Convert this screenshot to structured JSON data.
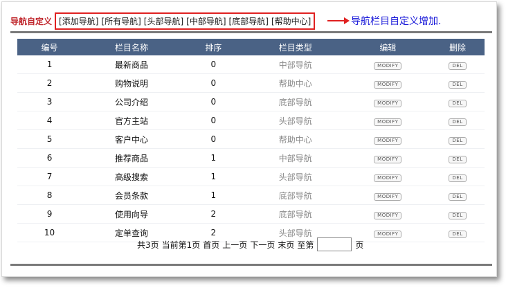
{
  "header": {
    "title": "导航自定义",
    "nav_links": [
      "[添加导航]",
      "[所有导航]",
      "[头部导航]",
      "[中部导航]",
      "[底部导航]",
      "[帮助中心]"
    ]
  },
  "annotation": "导航栏目自定义增加.",
  "table": {
    "columns": [
      "编号",
      "栏目名称",
      "排序",
      "栏目类型",
      "编辑",
      "删除"
    ],
    "rows": [
      {
        "id": "1",
        "name": "最新商品",
        "sort": "0",
        "type": "中部导航",
        "edit": "MODIFY",
        "del": "DEL"
      },
      {
        "id": "2",
        "name": "购物说明",
        "sort": "0",
        "type": "帮助中心",
        "edit": "MODIFY",
        "del": "DEL"
      },
      {
        "id": "3",
        "name": "公司介绍",
        "sort": "0",
        "type": "底部导航",
        "edit": "MODIFY",
        "del": "DEL"
      },
      {
        "id": "4",
        "name": "官方主站",
        "sort": "0",
        "type": "头部导航",
        "edit": "MODIFY",
        "del": "DEL"
      },
      {
        "id": "5",
        "name": "客户中心",
        "sort": "0",
        "type": "帮助中心",
        "edit": "MODIFY",
        "del": "DEL"
      },
      {
        "id": "6",
        "name": "推荐商品",
        "sort": "1",
        "type": "中部导航",
        "edit": "MODIFY",
        "del": "DEL"
      },
      {
        "id": "7",
        "name": "高级搜索",
        "sort": "1",
        "type": "头部导航",
        "edit": "MODIFY",
        "del": "DEL"
      },
      {
        "id": "8",
        "name": "会员条款",
        "sort": "1",
        "type": "底部导航",
        "edit": "MODIFY",
        "del": "DEL"
      },
      {
        "id": "9",
        "name": "使用向导",
        "sort": "2",
        "type": "底部导航",
        "edit": "MODIFY",
        "del": "DEL"
      },
      {
        "id": "10",
        "name": "定单查询",
        "sort": "2",
        "type": "头部导航",
        "edit": "MODIFY",
        "del": "DEL"
      }
    ]
  },
  "pager": {
    "total": "共3页",
    "current": "当前第1页",
    "first": "首页",
    "prev": "上一页",
    "next": "下一页",
    "last": "末页",
    "goto_prefix": "至第",
    "goto_suffix": "页",
    "goto_value": ""
  }
}
